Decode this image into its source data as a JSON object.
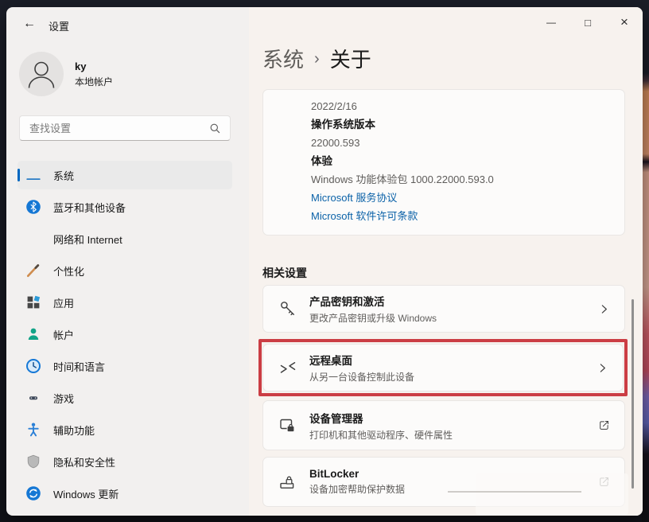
{
  "window": {
    "title": "设置"
  },
  "icons": {
    "back": "←",
    "minimize": "—",
    "maximize": "□",
    "close": "×",
    "breadcrumb_separator": "›"
  },
  "account": {
    "name": "ky",
    "type": "本地帐户"
  },
  "search": {
    "placeholder": "查找设置"
  },
  "sidebar": {
    "items": [
      {
        "key": "system",
        "label": "系统",
        "icon": "system-icon",
        "selected": true
      },
      {
        "key": "bluetooth",
        "label": "蓝牙和其他设备",
        "icon": "bluetooth-icon",
        "selected": false
      },
      {
        "key": "network",
        "label": "网络和 Internet",
        "icon": "network-icon",
        "selected": false
      },
      {
        "key": "personalization",
        "label": "个性化",
        "icon": "personalization-icon",
        "selected": false
      },
      {
        "key": "apps",
        "label": "应用",
        "icon": "apps-icon",
        "selected": false
      },
      {
        "key": "accounts",
        "label": "帐户",
        "icon": "accounts-icon",
        "selected": false
      },
      {
        "key": "time-language",
        "label": "时间和语言",
        "icon": "time-icon",
        "selected": false
      },
      {
        "key": "gaming",
        "label": "游戏",
        "icon": "gaming-icon",
        "selected": false
      },
      {
        "key": "accessibility",
        "label": "辅助功能",
        "icon": "accessibility-icon",
        "selected": false
      },
      {
        "key": "privacy-security",
        "label": "隐私和安全性",
        "icon": "privacy-icon",
        "selected": false
      },
      {
        "key": "windows-update",
        "label": "Windows 更新",
        "icon": "update-icon",
        "selected": false
      }
    ]
  },
  "breadcrumb": {
    "parent": "系统",
    "current": "关于"
  },
  "spec_card": {
    "rows": [
      {
        "style": "value",
        "text": "2022/2/16"
      },
      {
        "style": "label",
        "text": "操作系统版本"
      },
      {
        "style": "value",
        "text": "22000.593"
      },
      {
        "style": "label",
        "text": "体验"
      },
      {
        "style": "value",
        "text": "Windows 功能体验包 1000.22000.593.0"
      },
      {
        "style": "link",
        "text": "Microsoft 服务协议"
      },
      {
        "style": "link",
        "text": "Microsoft 软件许可条款"
      }
    ]
  },
  "related": {
    "heading": "相关设置",
    "cards": [
      {
        "key": "product-key-activation",
        "title": "产品密钥和激活",
        "subtitle": "更改产品密钥或升级 Windows",
        "icon": "key-icon",
        "action": "chevron",
        "highlighted": false
      },
      {
        "key": "remote-desktop",
        "title": "远程桌面",
        "subtitle": "从另一台设备控制此设备",
        "icon": "remote-desktop-icon",
        "action": "chevron",
        "highlighted": true
      },
      {
        "key": "device-manager",
        "title": "设备管理器",
        "subtitle": "打印机和其他驱动程序、硬件属性",
        "icon": "device-manager-icon",
        "action": "external",
        "highlighted": false
      },
      {
        "key": "bitlocker",
        "title": "BitLocker",
        "subtitle": "设备加密帮助保护数据",
        "icon": "bitlocker-icon",
        "action": "external",
        "highlighted": false,
        "action_faded": true
      }
    ]
  },
  "colors": {
    "accent_blue": "#0067c0",
    "link_blue": "#0b62a8",
    "highlight_red": "#cb3d44",
    "desktop_dark": "#1b1e28"
  }
}
